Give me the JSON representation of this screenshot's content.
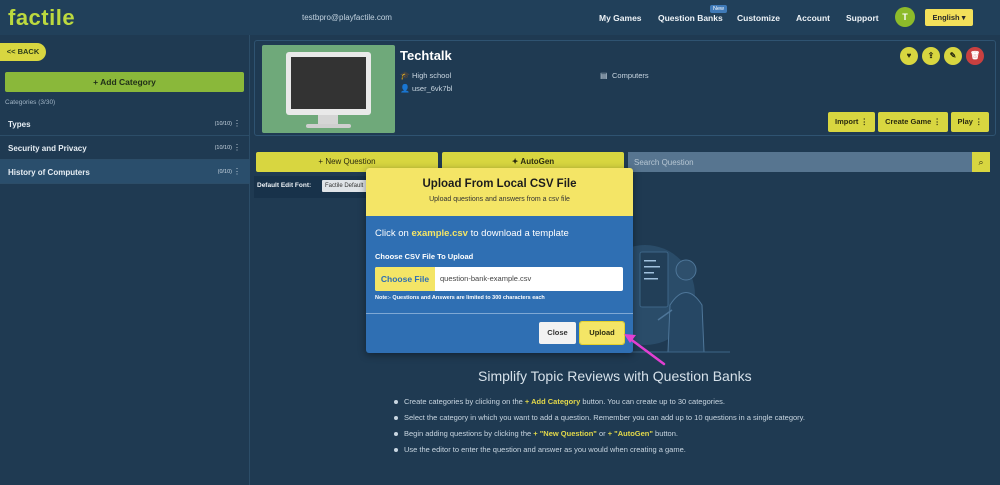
{
  "brand": {
    "logo": "factile"
  },
  "header": {
    "email": "testbpro@playfactile.com",
    "nav": [
      "My Games",
      "Question Banks",
      "Customize",
      "Account",
      "Support"
    ],
    "new_badge": "New",
    "avatar_initial": "T",
    "language": "English"
  },
  "sidebar": {
    "back": "<< BACK",
    "add_category": "+ Add Category",
    "categories_count": "Categories (3/30)",
    "categories": [
      {
        "label": "Types",
        "count": "(10/10)"
      },
      {
        "label": "Security and Privacy",
        "count": "(10/10)"
      },
      {
        "label": "History of Computers",
        "count": "(0/10)"
      }
    ]
  },
  "bank": {
    "title": "Techtalk",
    "level": "High school",
    "user": "user_6vk7bl",
    "subject": "Computers",
    "actions": {
      "import": "Import",
      "create_game": "Create Game",
      "play": "Play"
    }
  },
  "toolbar": {
    "new_question": "+ New Question",
    "autogen": "AutoGen",
    "search_placeholder": "Search Question",
    "default_font_label": "Default Edit Font:",
    "default_font_value": "Factile Default"
  },
  "empty_state": {
    "title": "Simplify Topic Reviews with Question Banks",
    "tips": [
      {
        "pre": "Create categories by clicking on the ",
        "hl": "+ Add Category",
        "post": " button. You can create up to 30 categories."
      },
      {
        "pre": "Select the category in which you want to add a question. Remember you can add up to 10 questions in a single category.",
        "hl": "",
        "post": ""
      },
      {
        "pre": "Begin adding questions by clicking the ",
        "hl": "+ \"New Question\"",
        "mid": " or ",
        "hl2": "+ \"AutoGen\"",
        "post": " button."
      },
      {
        "pre": "Use the editor to enter the question and answer as you would when creating a game.",
        "hl": "",
        "post": ""
      }
    ]
  },
  "modal": {
    "title": "Upload From Local CSV File",
    "subtitle": "Upload questions and answers from a csv file",
    "info_pre": "Click on ",
    "info_link": "example.csv",
    "info_post": " to download a template",
    "choose_label": "Choose CSV File To Upload",
    "choose_button": "Choose File",
    "file_name": "question-bank-example.csv",
    "note": "Note:- Questions and Answers are limited to 300 characters each",
    "close": "Close",
    "upload": "Upload"
  },
  "colors": {
    "accent_yellow": "#f4e566",
    "brand_green": "#bcd93f",
    "modal_blue": "#2f6fb3",
    "arrow_magenta": "#e23fd2",
    "background": "#1f3a52"
  }
}
